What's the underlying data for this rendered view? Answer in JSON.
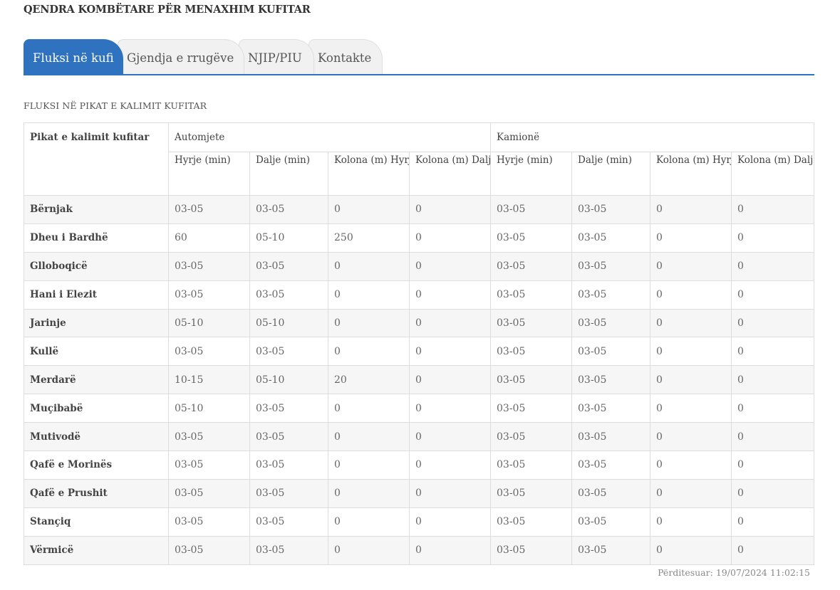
{
  "site_title": "QENDRA KOMBËTARE PËR MENAXHIM KUFITAR",
  "tabs": [
    {
      "label": "Fluksi në kufi",
      "active": true
    },
    {
      "label": "Gjendja e rrugëve",
      "active": false
    },
    {
      "label": "NJIP/PIU",
      "active": false
    },
    {
      "label": "Kontakte",
      "active": false
    }
  ],
  "section_caption": "FLUKSI NË PIKAT E KALIMIT KUFITAR",
  "table": {
    "col_first": "Pikat e kalimit kufitar",
    "group_autos": "Automjete",
    "group_trucks": "Kamionë",
    "sub_headers": [
      "Hyrje (min)",
      "Dalje (min)",
      "Kolona (m) Hyrje",
      "Kolona (m) Dalje",
      "Hyrje (min)",
      "Dalje (min)",
      "Kolona (m) Hyrje",
      "Kolona (m) Dalje"
    ],
    "rows": [
      {
        "name": "Bërnjak",
        "cells": [
          "03-05",
          "03-05",
          "0",
          "0",
          "03-05",
          "03-05",
          "0",
          "0"
        ]
      },
      {
        "name": "Dheu i Bardhë",
        "cells": [
          "60",
          "05-10",
          "250",
          "0",
          "03-05",
          "03-05",
          "0",
          "0"
        ]
      },
      {
        "name": "Glloboqicë",
        "cells": [
          "03-05",
          "03-05",
          "0",
          "0",
          "03-05",
          "03-05",
          "0",
          "0"
        ]
      },
      {
        "name": "Hani i Elezit",
        "cells": [
          "03-05",
          "03-05",
          "0",
          "0",
          "03-05",
          "03-05",
          "0",
          "0"
        ]
      },
      {
        "name": "Jarinje",
        "cells": [
          "05-10",
          "05-10",
          "0",
          "0",
          "03-05",
          "03-05",
          "0",
          "0"
        ]
      },
      {
        "name": "Kullë",
        "cells": [
          "03-05",
          "03-05",
          "0",
          "0",
          "03-05",
          "03-05",
          "0",
          "0"
        ]
      },
      {
        "name": "Merdarë",
        "cells": [
          "10-15",
          "05-10",
          "20",
          "0",
          "03-05",
          "03-05",
          "0",
          "0"
        ]
      },
      {
        "name": "Muçibabë",
        "cells": [
          "05-10",
          "03-05",
          "0",
          "0",
          "03-05",
          "03-05",
          "0",
          "0"
        ]
      },
      {
        "name": "Mutivodë",
        "cells": [
          "03-05",
          "03-05",
          "0",
          "0",
          "03-05",
          "03-05",
          "0",
          "0"
        ]
      },
      {
        "name": "Qafë e Morinës",
        "cells": [
          "03-05",
          "03-05",
          "0",
          "0",
          "03-05",
          "03-05",
          "0",
          "0"
        ]
      },
      {
        "name": "Qafë e Prushit",
        "cells": [
          "03-05",
          "03-05",
          "0",
          "0",
          "03-05",
          "03-05",
          "0",
          "0"
        ]
      },
      {
        "name": "Stançiq",
        "cells": [
          "03-05",
          "03-05",
          "0",
          "0",
          "03-05",
          "03-05",
          "0",
          "0"
        ]
      },
      {
        "name": "Vërmicë",
        "cells": [
          "03-05",
          "03-05",
          "0",
          "0",
          "03-05",
          "03-05",
          "0",
          "0"
        ]
      }
    ]
  },
  "updated": {
    "label": "Përditesuar:",
    "value": "19/07/2024 11:02:15"
  },
  "colors": {
    "accent": "#2f72bf",
    "tab_inactive": "#f1f1f1",
    "row_striped": "#f6f6f6",
    "border": "#dddddd"
  }
}
